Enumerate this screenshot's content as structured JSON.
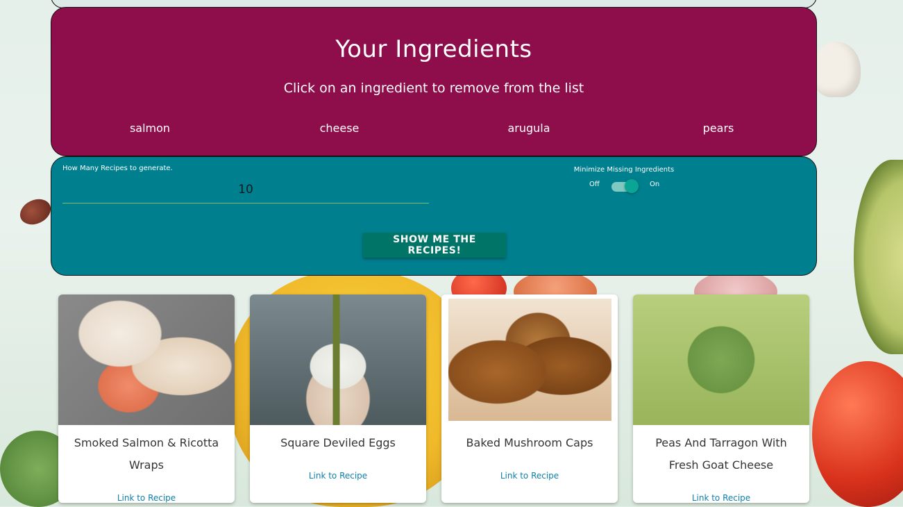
{
  "ingredients_panel": {
    "title": "Your Ingredients",
    "subtitle": "Click on an ingredient to remove from the list",
    "items": [
      "salmon",
      "cheese",
      "arugula",
      "pears"
    ]
  },
  "settings": {
    "recipe_count_label": "How Many Recipes to generate.",
    "recipe_count_value": "10",
    "toggle_label": "Minimize Missing Ingredients",
    "toggle_off_label": "Off",
    "toggle_on_label": "On",
    "toggle_state": "on",
    "submit_label": "SHOW ME THE RECIPES!"
  },
  "recipes": [
    {
      "title": "Smoked Salmon & Ricotta Wraps",
      "link_label": "Link to Recipe",
      "image": "salmon-wrap-photo"
    },
    {
      "title": "Square Deviled Eggs",
      "link_label": "Link to Recipe",
      "image": "deviled-eggs-photo"
    },
    {
      "title": "Baked Mushroom Caps",
      "link_label": "Link to Recipe",
      "image": "mushroom-caps-photo"
    },
    {
      "title": "Peas And Tarragon With Fresh Goat Cheese",
      "link_label": "Link to Recipe",
      "image": "peas-dish-photo"
    }
  ],
  "colors": {
    "ingredients_bg": "#8e0d4b",
    "settings_bg": "#007f8e",
    "button_bg": "#007466",
    "link": "#0d7fa8"
  }
}
